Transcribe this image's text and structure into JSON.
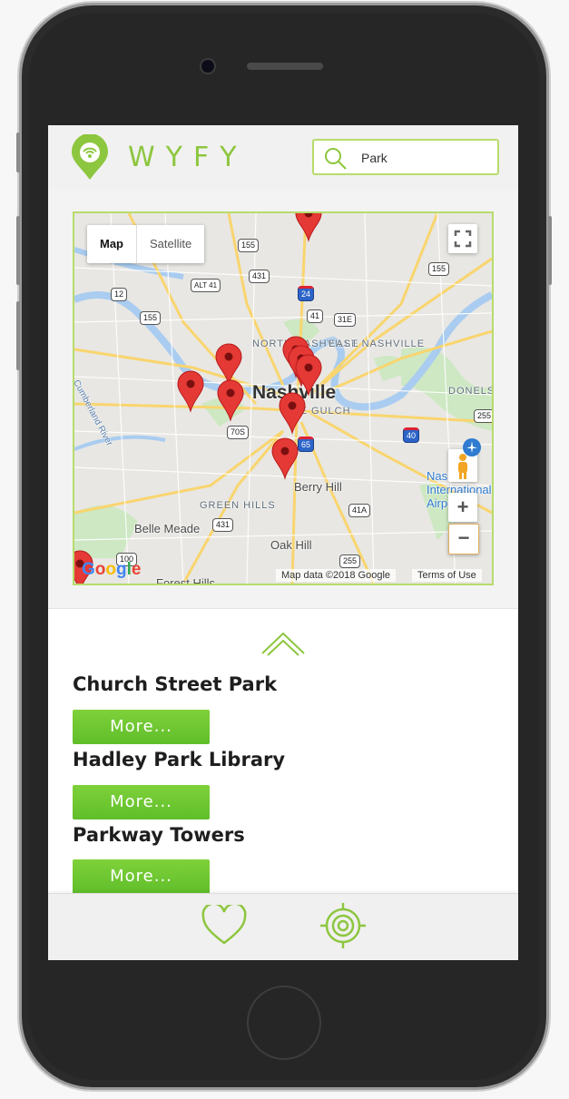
{
  "header": {
    "logo_text": "WYFY",
    "search": {
      "value": "Park",
      "placeholder": "Search"
    }
  },
  "map": {
    "toggle": {
      "map_label": "Map",
      "satellite_label": "Satellite"
    },
    "labels": {
      "nashville": "Nashville",
      "east_nashville": "EAST NASHVILLE",
      "north_nashville": "NORTH NASHVILLE",
      "the_gulch": "THE GULCH",
      "donelson": "DONELS",
      "green_hills": "GREEN HILLS",
      "belle_meade": "Belle Meade",
      "berry_hill": "Berry Hill",
      "oak_hill": "Oak Hill",
      "forest_hills": "Forest Hills",
      "cumberland_river": "Cumberland River",
      "airport": "Nashville International Airport"
    },
    "shields": [
      "155",
      "431",
      "ALT 41",
      "12",
      "155",
      "24",
      "41",
      "31E",
      "155",
      "70S",
      "65",
      "40",
      "255",
      "431",
      "41A",
      "100",
      "255"
    ],
    "zoom_in": "+",
    "zoom_out": "−",
    "google": "Google",
    "attribution": "Map data ©2018 Google",
    "terms": "Terms of Use",
    "pin_color": "#e53935"
  },
  "results": [
    {
      "title": "Church Street Park",
      "button": "More..."
    },
    {
      "title": "Hadley Park Library",
      "button": "More..."
    },
    {
      "title": "Parkway Towers",
      "button": "More..."
    }
  ],
  "colors": {
    "accent": "#8dc63f",
    "button": "#6cc631"
  },
  "bottom_nav": {
    "icons": [
      "heart-icon",
      "target-icon"
    ]
  }
}
